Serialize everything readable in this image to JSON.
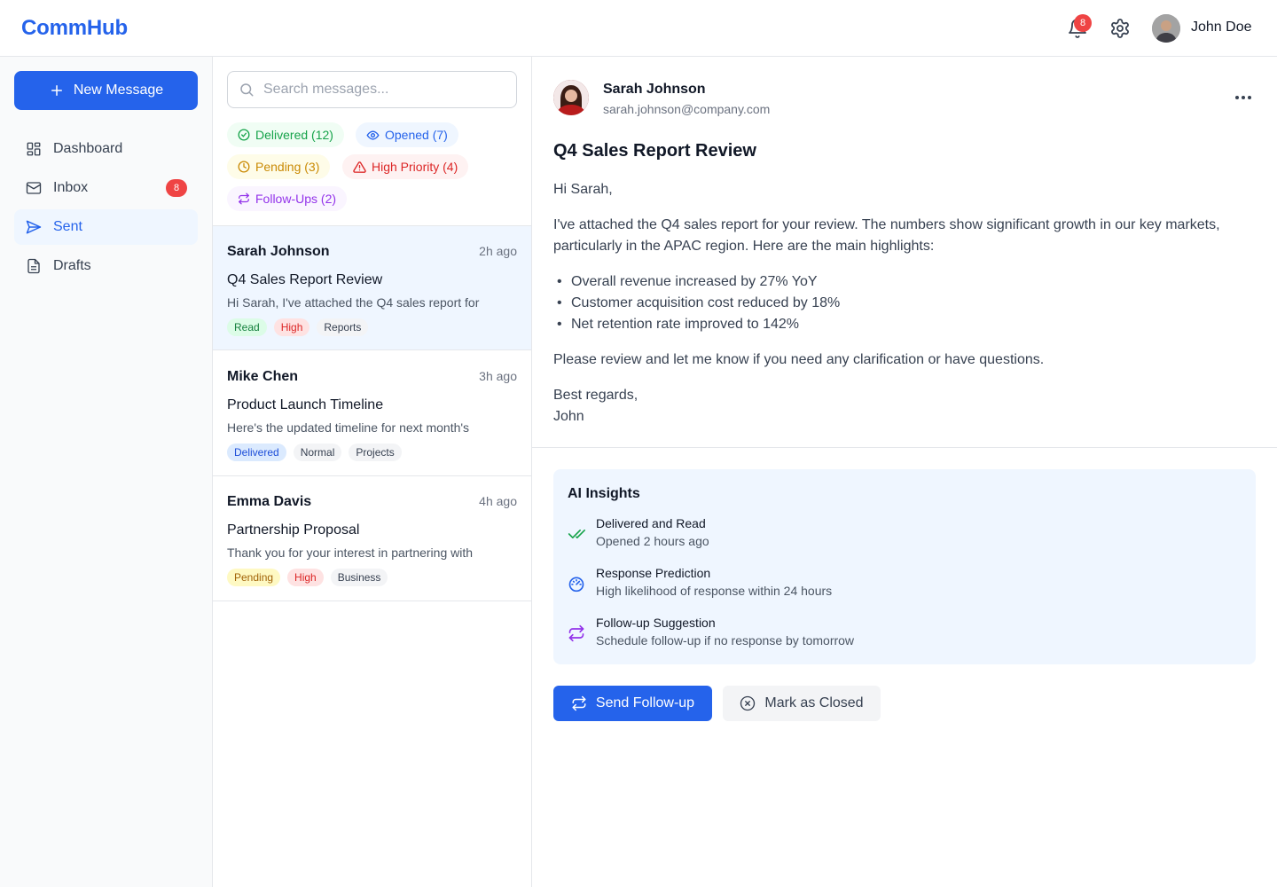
{
  "app": {
    "name": "CommHub"
  },
  "header": {
    "notification_count": "8",
    "user_name": "John Doe",
    "icons": [
      "bell-icon",
      "gear-icon",
      "avatar"
    ]
  },
  "sidebar": {
    "new_message_label": "New Message",
    "items": [
      {
        "label": "Dashboard",
        "icon": "dashboard-icon",
        "active": false
      },
      {
        "label": "Inbox",
        "icon": "mail-icon",
        "badge": "8",
        "active": false
      },
      {
        "label": "Sent",
        "icon": "send-icon",
        "active": true
      },
      {
        "label": "Drafts",
        "icon": "document-icon",
        "active": false
      }
    ]
  },
  "list": {
    "search_placeholder": "Search messages...",
    "filters": [
      {
        "label": "Delivered (12)",
        "icon": "check-circle-icon",
        "color": "#16a34a",
        "bg": "#f0fdf4"
      },
      {
        "label": "Opened (7)",
        "icon": "eye-icon",
        "color": "#2563eb",
        "bg": "#eff6ff"
      },
      {
        "label": "Pending (3)",
        "icon": "clock-icon",
        "color": "#ca8a04",
        "bg": "#fefce8"
      },
      {
        "label": "High Priority (4)",
        "icon": "warning-icon",
        "color": "#dc2626",
        "bg": "#fef2f2"
      },
      {
        "label": "Follow-Ups (2)",
        "icon": "repeat-icon",
        "color": "#9333ea",
        "bg": "#faf5ff"
      }
    ],
    "messages": [
      {
        "from": "Sarah Johnson",
        "time": "2h ago",
        "subject": "Q4 Sales Report Review",
        "preview": "Hi Sarah, I've attached the Q4 sales report for",
        "tags": [
          {
            "label": "Read",
            "color": "#15803d",
            "bg": "#dcfce7"
          },
          {
            "label": "High",
            "color": "#dc2626",
            "bg": "#fee2e2"
          },
          {
            "label": "Reports",
            "color": "#374151",
            "bg": "#f3f4f6"
          }
        ],
        "selected": true
      },
      {
        "from": "Mike Chen",
        "time": "3h ago",
        "subject": "Product Launch Timeline",
        "preview": "Here's the updated timeline for next month's",
        "tags": [
          {
            "label": "Delivered",
            "color": "#1d4ed8",
            "bg": "#dbeafe"
          },
          {
            "label": "Normal",
            "color": "#374151",
            "bg": "#f3f4f6"
          },
          {
            "label": "Projects",
            "color": "#374151",
            "bg": "#f3f4f6"
          }
        ],
        "selected": false
      },
      {
        "from": "Emma Davis",
        "time": "4h ago",
        "subject": "Partnership Proposal",
        "preview": "Thank you for your interest in partnering with",
        "tags": [
          {
            "label": "Pending",
            "color": "#a16207",
            "bg": "#fef9c3"
          },
          {
            "label": "High",
            "color": "#dc2626",
            "bg": "#fee2e2"
          },
          {
            "label": "Business",
            "color": "#374151",
            "bg": "#f3f4f6"
          }
        ],
        "selected": false
      }
    ]
  },
  "detail": {
    "sender_name": "Sarah Johnson",
    "sender_email": "sarah.johnson@company.com",
    "subject": "Q4 Sales Report Review",
    "greeting": "Hi Sarah,",
    "intro": "I've attached the Q4 sales report for your review. The numbers show significant growth in our key markets, particularly in the APAC region. Here are the main highlights:",
    "bullets": [
      "Overall revenue increased by 27% YoY",
      "Customer acquisition cost reduced by 18%",
      "Net retention rate improved to 142%"
    ],
    "closing": "Please review and let me know if you need any clarification or have questions.",
    "signoff": "Best regards,",
    "signature": "John",
    "insights": {
      "title": "AI Insights",
      "items": [
        {
          "heading": "Delivered and Read",
          "detail": "Opened 2 hours ago",
          "icon": "double-check-icon",
          "color": "#16a34a"
        },
        {
          "heading": "Response Prediction",
          "detail": "High likelihood of response within 24 hours",
          "icon": "gauge-icon",
          "color": "#2563eb"
        },
        {
          "heading": "Follow-up Suggestion",
          "detail": "Schedule follow-up if no response by tomorrow",
          "icon": "repeat-icon",
          "color": "#9333ea"
        }
      ]
    },
    "actions": {
      "follow_up_label": "Send Follow-up",
      "close_label": "Mark as Closed"
    }
  },
  "colors": {
    "accent": "#2563eb",
    "badge": "#ef4444",
    "selected_row": "#eff6ff"
  }
}
